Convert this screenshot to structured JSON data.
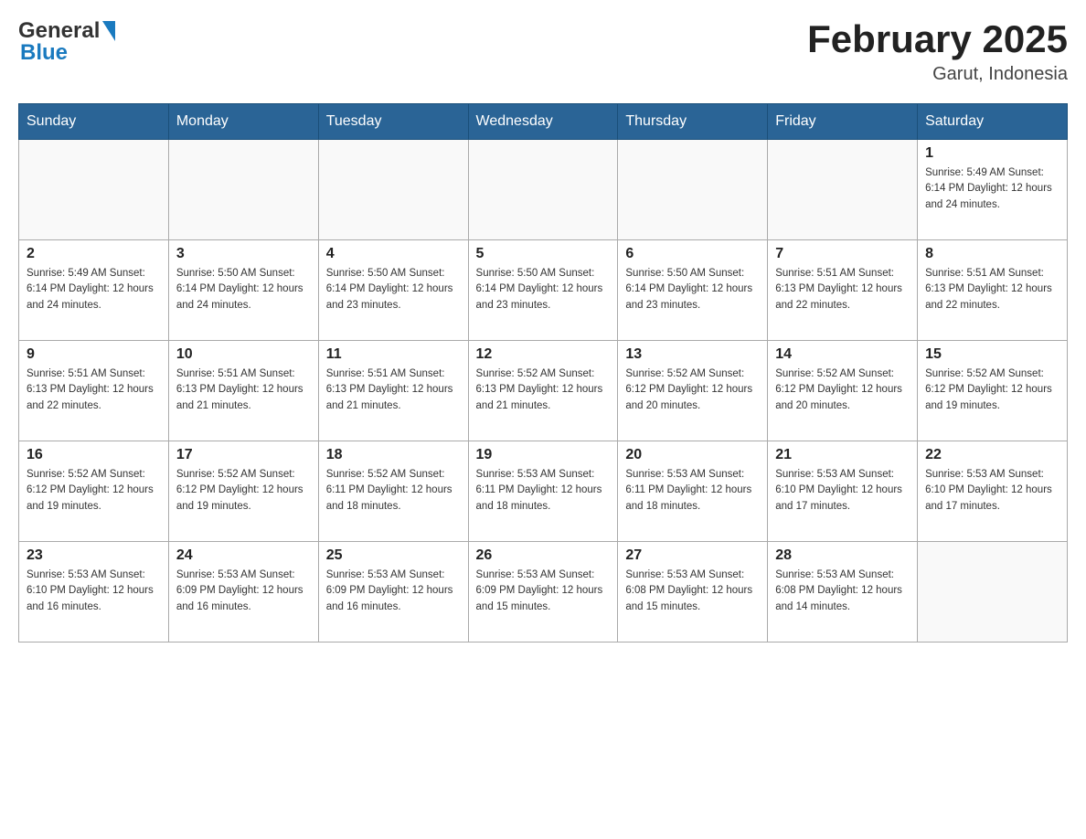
{
  "header": {
    "logo_general": "General",
    "logo_blue": "Blue",
    "month_title": "February 2025",
    "location": "Garut, Indonesia"
  },
  "days_of_week": [
    "Sunday",
    "Monday",
    "Tuesday",
    "Wednesday",
    "Thursday",
    "Friday",
    "Saturday"
  ],
  "weeks": [
    {
      "cells": [
        {
          "day": null,
          "info": null
        },
        {
          "day": null,
          "info": null
        },
        {
          "day": null,
          "info": null
        },
        {
          "day": null,
          "info": null
        },
        {
          "day": null,
          "info": null
        },
        {
          "day": null,
          "info": null
        },
        {
          "day": "1",
          "info": "Sunrise: 5:49 AM\nSunset: 6:14 PM\nDaylight: 12 hours\nand 24 minutes."
        }
      ]
    },
    {
      "cells": [
        {
          "day": "2",
          "info": "Sunrise: 5:49 AM\nSunset: 6:14 PM\nDaylight: 12 hours\nand 24 minutes."
        },
        {
          "day": "3",
          "info": "Sunrise: 5:50 AM\nSunset: 6:14 PM\nDaylight: 12 hours\nand 24 minutes."
        },
        {
          "day": "4",
          "info": "Sunrise: 5:50 AM\nSunset: 6:14 PM\nDaylight: 12 hours\nand 23 minutes."
        },
        {
          "day": "5",
          "info": "Sunrise: 5:50 AM\nSunset: 6:14 PM\nDaylight: 12 hours\nand 23 minutes."
        },
        {
          "day": "6",
          "info": "Sunrise: 5:50 AM\nSunset: 6:14 PM\nDaylight: 12 hours\nand 23 minutes."
        },
        {
          "day": "7",
          "info": "Sunrise: 5:51 AM\nSunset: 6:13 PM\nDaylight: 12 hours\nand 22 minutes."
        },
        {
          "day": "8",
          "info": "Sunrise: 5:51 AM\nSunset: 6:13 PM\nDaylight: 12 hours\nand 22 minutes."
        }
      ]
    },
    {
      "cells": [
        {
          "day": "9",
          "info": "Sunrise: 5:51 AM\nSunset: 6:13 PM\nDaylight: 12 hours\nand 22 minutes."
        },
        {
          "day": "10",
          "info": "Sunrise: 5:51 AM\nSunset: 6:13 PM\nDaylight: 12 hours\nand 21 minutes."
        },
        {
          "day": "11",
          "info": "Sunrise: 5:51 AM\nSunset: 6:13 PM\nDaylight: 12 hours\nand 21 minutes."
        },
        {
          "day": "12",
          "info": "Sunrise: 5:52 AM\nSunset: 6:13 PM\nDaylight: 12 hours\nand 21 minutes."
        },
        {
          "day": "13",
          "info": "Sunrise: 5:52 AM\nSunset: 6:12 PM\nDaylight: 12 hours\nand 20 minutes."
        },
        {
          "day": "14",
          "info": "Sunrise: 5:52 AM\nSunset: 6:12 PM\nDaylight: 12 hours\nand 20 minutes."
        },
        {
          "day": "15",
          "info": "Sunrise: 5:52 AM\nSunset: 6:12 PM\nDaylight: 12 hours\nand 19 minutes."
        }
      ]
    },
    {
      "cells": [
        {
          "day": "16",
          "info": "Sunrise: 5:52 AM\nSunset: 6:12 PM\nDaylight: 12 hours\nand 19 minutes."
        },
        {
          "day": "17",
          "info": "Sunrise: 5:52 AM\nSunset: 6:12 PM\nDaylight: 12 hours\nand 19 minutes."
        },
        {
          "day": "18",
          "info": "Sunrise: 5:52 AM\nSunset: 6:11 PM\nDaylight: 12 hours\nand 18 minutes."
        },
        {
          "day": "19",
          "info": "Sunrise: 5:53 AM\nSunset: 6:11 PM\nDaylight: 12 hours\nand 18 minutes."
        },
        {
          "day": "20",
          "info": "Sunrise: 5:53 AM\nSunset: 6:11 PM\nDaylight: 12 hours\nand 18 minutes."
        },
        {
          "day": "21",
          "info": "Sunrise: 5:53 AM\nSunset: 6:10 PM\nDaylight: 12 hours\nand 17 minutes."
        },
        {
          "day": "22",
          "info": "Sunrise: 5:53 AM\nSunset: 6:10 PM\nDaylight: 12 hours\nand 17 minutes."
        }
      ]
    },
    {
      "cells": [
        {
          "day": "23",
          "info": "Sunrise: 5:53 AM\nSunset: 6:10 PM\nDaylight: 12 hours\nand 16 minutes."
        },
        {
          "day": "24",
          "info": "Sunrise: 5:53 AM\nSunset: 6:09 PM\nDaylight: 12 hours\nand 16 minutes."
        },
        {
          "day": "25",
          "info": "Sunrise: 5:53 AM\nSunset: 6:09 PM\nDaylight: 12 hours\nand 16 minutes."
        },
        {
          "day": "26",
          "info": "Sunrise: 5:53 AM\nSunset: 6:09 PM\nDaylight: 12 hours\nand 15 minutes."
        },
        {
          "day": "27",
          "info": "Sunrise: 5:53 AM\nSunset: 6:08 PM\nDaylight: 12 hours\nand 15 minutes."
        },
        {
          "day": "28",
          "info": "Sunrise: 5:53 AM\nSunset: 6:08 PM\nDaylight: 12 hours\nand 14 minutes."
        },
        {
          "day": null,
          "info": null
        }
      ]
    }
  ]
}
